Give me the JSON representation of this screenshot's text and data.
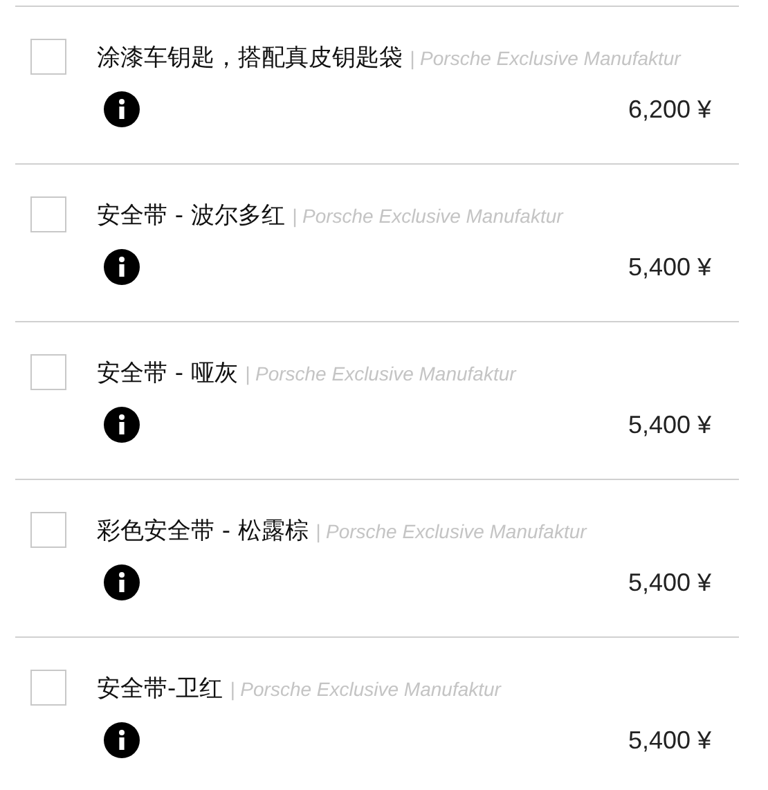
{
  "items": [
    {
      "title": "涂漆车钥匙，搭配真皮钥匙袋",
      "brand": "| Porsche Exclusive Manufaktur",
      "price": "6,200 ¥",
      "checked": false
    },
    {
      "title": "安全带 - 波尔多红",
      "brand": "| Porsche Exclusive Manufaktur",
      "price": "5,400 ¥",
      "checked": false
    },
    {
      "title": "安全带 - 哑灰",
      "brand": "| Porsche Exclusive Manufaktur",
      "price": "5,400 ¥",
      "checked": false
    },
    {
      "title": "彩色安全带 - 松露棕",
      "brand": "| Porsche Exclusive Manufaktur",
      "price": "5,400 ¥",
      "checked": false
    },
    {
      "title": "安全带-卫红",
      "brand": "| Porsche Exclusive Manufaktur",
      "price": "5,400 ¥",
      "checked": false
    }
  ]
}
